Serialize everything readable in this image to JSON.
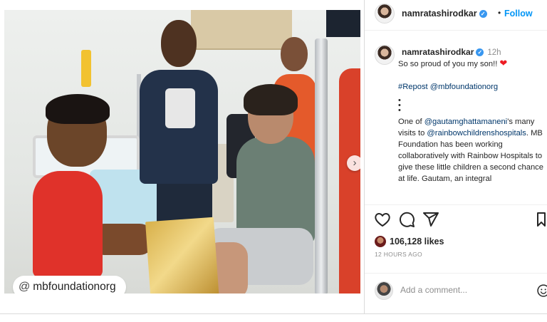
{
  "media": {
    "watermark_text": "mbfoundationorg",
    "watermark_symbol": "@",
    "next_arrow": "›"
  },
  "header": {
    "username": "namratashirodkar",
    "separator": "•",
    "follow_label": "Follow"
  },
  "caption": {
    "username": "namratashirodkar",
    "time": "12h",
    "line1": "So so proud of you my son!!",
    "heart": "❤",
    "repost": "#Repost @mbfoundationorg",
    "dots": "•\n•\n•",
    "body_prefix": "One of ",
    "mention1": "@gautamghattamaneni",
    "body_mid": "'s many visits to ",
    "mention2": "@rainbowchildrenshospitals",
    "body_rest": ". MB Foundation has been working collaboratively with Rainbow Hospitals to give these little children a second chance at life. Gautam, an integral"
  },
  "actions": {
    "likes": "106,128 likes",
    "time_ago": "12 HOURS AGO"
  },
  "comment": {
    "placeholder": "Add a comment..."
  },
  "colors": {
    "follow_blue": "#0095f6",
    "verified_blue": "#3897f0",
    "mention_blue": "#00376b",
    "heart_red": "#ed1c24"
  },
  "icons": [
    "verified-badge-icon",
    "heart-icon",
    "comment-icon",
    "share-icon",
    "bookmark-icon",
    "emoji-icon",
    "carousel-next-icon"
  ]
}
